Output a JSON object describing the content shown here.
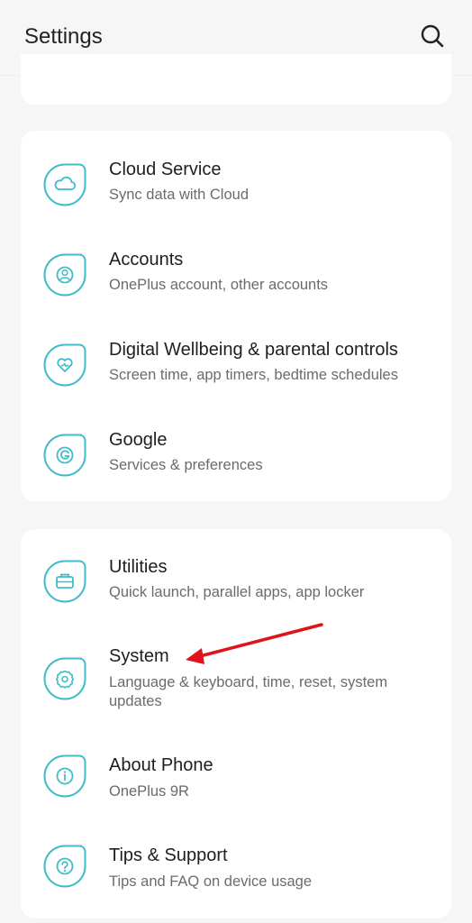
{
  "header": {
    "title": "Settings",
    "search_icon": "search-icon"
  },
  "accent_color": "#3fbcc7",
  "annotation_color": "#e0131a",
  "group_1": [
    {
      "title": "Cloud Service",
      "subtitle": "Sync data with Cloud",
      "icon": "cloud-icon"
    },
    {
      "title": "Accounts",
      "subtitle": "OnePlus account, other accounts",
      "icon": "account-icon"
    },
    {
      "title": "Digital Wellbeing & parental controls",
      "subtitle": "Screen time, app timers, bedtime schedules",
      "icon": "wellbeing-heart-icon"
    },
    {
      "title": "Google",
      "subtitle": "Services & preferences",
      "icon": "google-icon"
    }
  ],
  "group_2": [
    {
      "title": "Utilities",
      "subtitle": "Quick launch, parallel apps, app locker",
      "icon": "toolbox-icon"
    },
    {
      "title": "System",
      "subtitle": "Language & keyboard, time, reset, system updates",
      "icon": "gear-icon"
    },
    {
      "title": "About Phone",
      "subtitle": "OnePlus 9R",
      "icon": "info-icon"
    },
    {
      "title": "Tips & Support",
      "subtitle": "Tips and FAQ on device usage",
      "icon": "help-icon"
    }
  ]
}
